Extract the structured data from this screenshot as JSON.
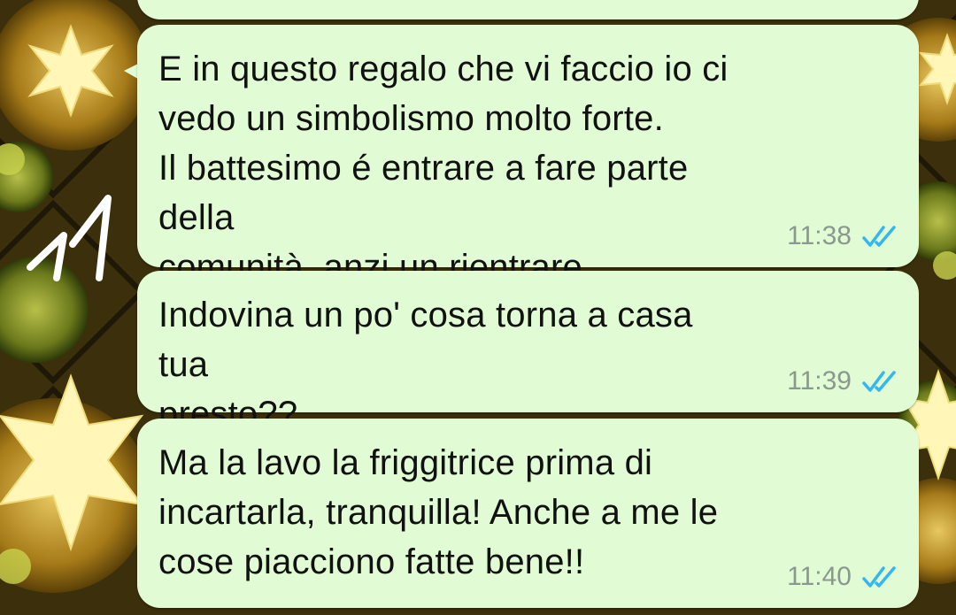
{
  "chat": {
    "messages": [
      {
        "text": "E in questo regalo che vi faccio io ci\nvedo un simbolismo molto forte.\nIl battesimo é entrare a fare parte della\ncomunità, anzi un rientrare..",
        "time": "11:38",
        "status": "read"
      },
      {
        "text": "Indovina un po' cosa torna a casa tua\npresto??",
        "time": "11:39",
        "status": "read"
      },
      {
        "text": "Ma la lavo la friggitrice prima di\nincartarla, tranquilla! Anche a me le\ncose piacciono fatte bene!!",
        "time": "11:40",
        "status": "read"
      }
    ]
  },
  "annotation": {
    "handwritten_number": "11"
  },
  "colors": {
    "bubble": "#e1fcd4",
    "read_ticks": "#34b7f1",
    "time_text": "#8a9890"
  },
  "icons": {
    "read_status": "double-check-icon",
    "wallpaper": "star-pattern-wallpaper"
  }
}
